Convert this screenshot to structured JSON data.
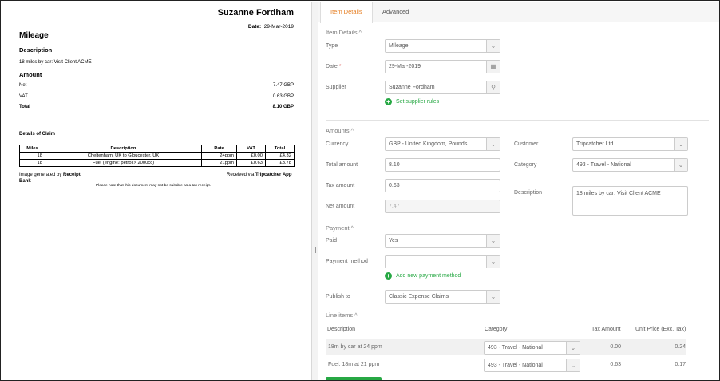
{
  "document": {
    "name": "Suzanne Fordham",
    "date_label": "Date:",
    "date": "29-Mar-2019",
    "title": "Mileage",
    "description_heading": "Description",
    "description": "18 miles by car: Visit Client ACME",
    "amount_heading": "Amount",
    "amounts": [
      {
        "label": "Net",
        "value": "7.47 GBP"
      },
      {
        "label": "VAT",
        "value": "0.63 GBP"
      },
      {
        "label": "Total",
        "value": "8.10 GBP"
      }
    ],
    "claim_heading": "Details of Claim",
    "claim_columns": [
      "Miles",
      "Description",
      "Rate",
      "VAT",
      "Total"
    ],
    "claim_rows": [
      [
        "18",
        "Cheltenham, UK to Gloucester, UK",
        "24ppm",
        "£0.00",
        "£4.32"
      ],
      [
        "18",
        "Fuel (engine: petrol > 2000cc)",
        "21ppm",
        "£0.63",
        "£3.78"
      ]
    ],
    "generated_prefix": "Image generated by",
    "generated_by": "Receipt Bank",
    "received_prefix": "Received via",
    "received_via": "Tripcatcher App",
    "notice": "Please note that this document may not be suitable as a tax receipt."
  },
  "tabs": [
    "Item Details",
    "Advanced"
  ],
  "item_details": {
    "heading": "Item Details",
    "type_label": "Type",
    "type_value": "Mileage",
    "date_label": "Date",
    "date_required": "*",
    "date_value": "29-Mar-2019",
    "supplier_label": "Supplier",
    "supplier_value": "Suzanne Fordham",
    "supplier_rules_link": "Set supplier rules"
  },
  "amounts": {
    "heading": "Amounts",
    "currency_label": "Currency",
    "currency_value": "GBP - United Kingdom, Pounds",
    "total_label": "Total amount",
    "total_value": "8.10",
    "tax_label": "Tax amount",
    "tax_value": "0.63",
    "net_label": "Net amount",
    "net_value": "7.47",
    "customer_label": "Customer",
    "customer_value": "Tripcatcher Ltd",
    "category_label": "Category",
    "category_value": "493 - Travel - National",
    "description_label": "Description",
    "description_value": "18 miles by car: Visit Client ACME"
  },
  "payment": {
    "heading": "Payment",
    "paid_label": "Paid",
    "paid_value": "Yes",
    "method_label": "Payment method",
    "method_value": "",
    "add_method_link": "Add new payment method",
    "publish_label": "Publish to",
    "publish_value": "Classic Expense Claims"
  },
  "line_items": {
    "heading": "Line items",
    "columns": [
      "Description",
      "Category",
      "Tax Amount",
      "Unit Price (Exc. Tax)"
    ],
    "rows": [
      {
        "description": "18m by car at 24 ppm",
        "category": "493 - Travel - National",
        "tax": "0.00",
        "unit_price": "0.24"
      },
      {
        "description": "Fuel: 18m at 21 ppm",
        "category": "493 - Travel - National",
        "tax": "0.63",
        "unit_price": "0.17"
      }
    ]
  },
  "icons": {
    "chevron": "⌄",
    "caret_up": "^",
    "calendar": "▦",
    "search": "⚲",
    "plus": "+"
  },
  "colors": {
    "accent_tab": "#e67e22",
    "link_green": "#27a844",
    "required": "#d9534f"
  }
}
